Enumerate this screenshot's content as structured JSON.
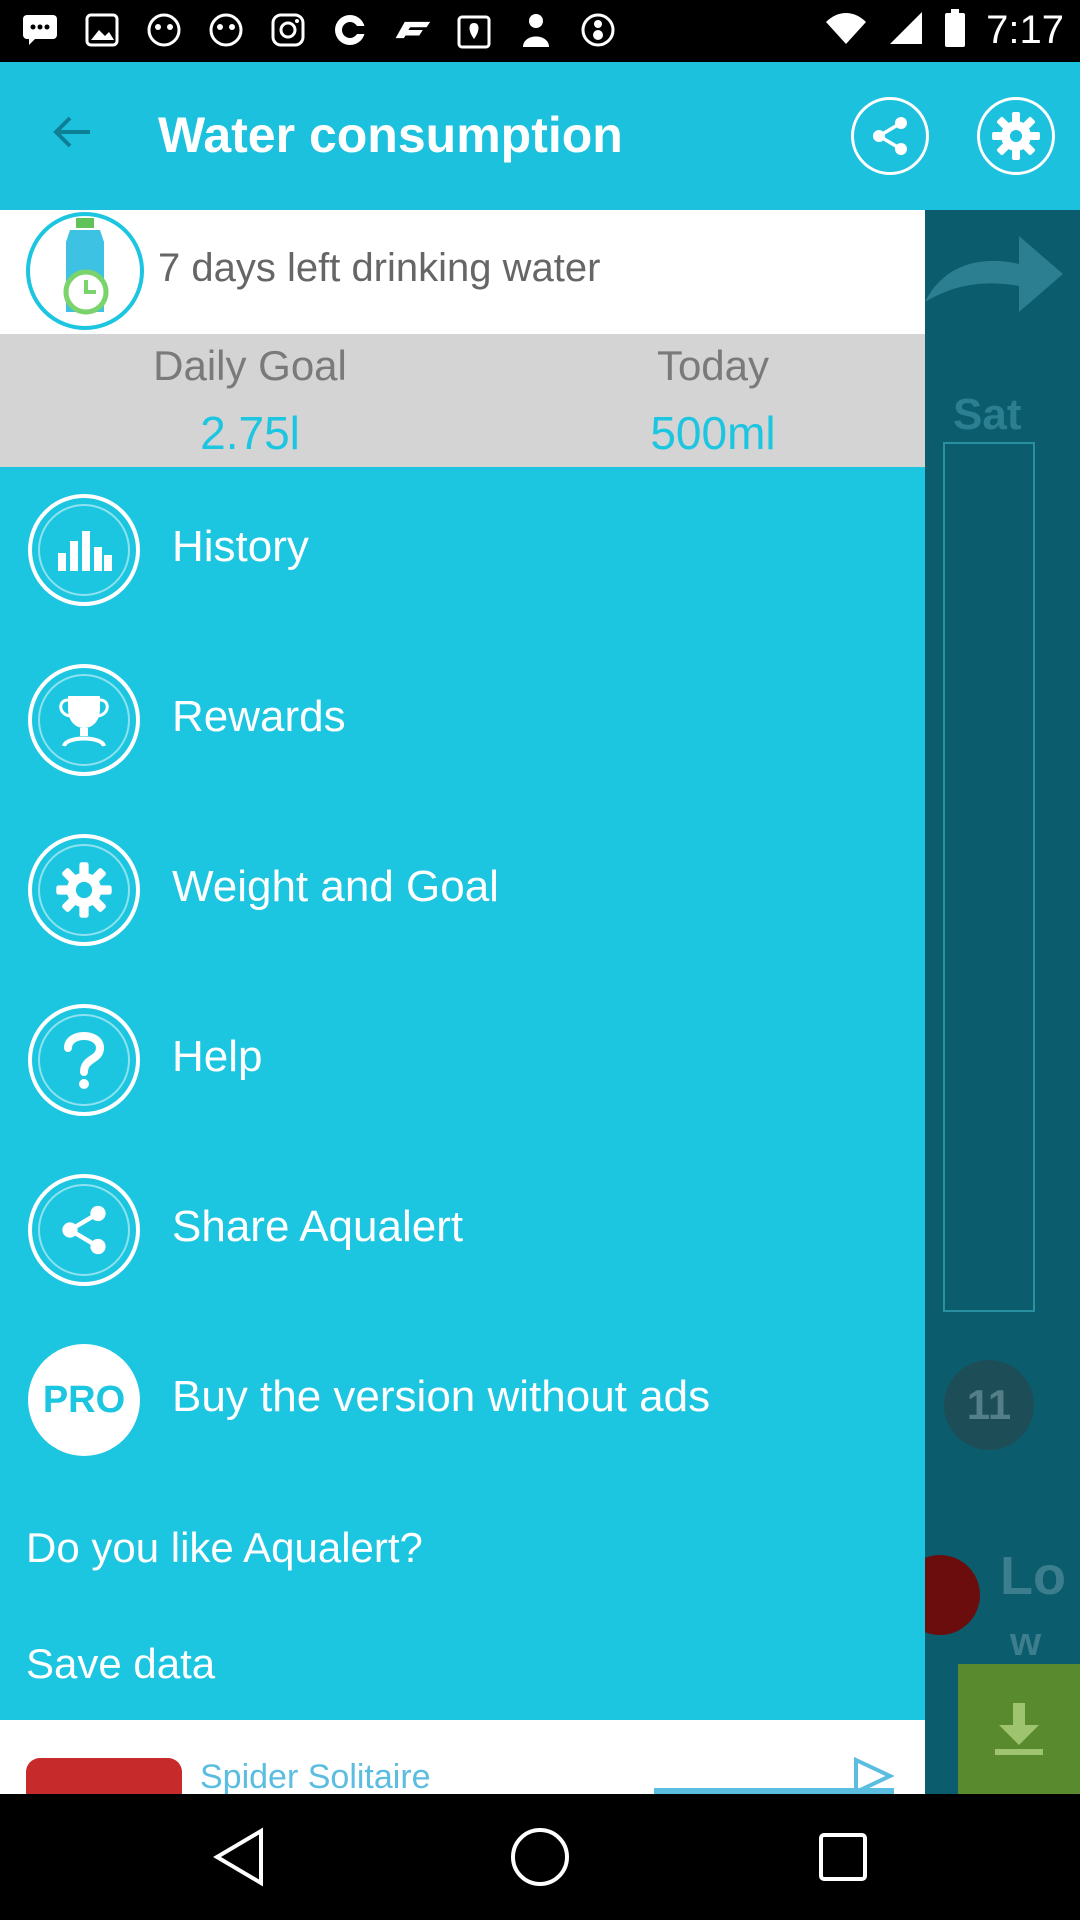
{
  "status_bar": {
    "time": "7:17",
    "left_icons": [
      "message-icon",
      "photo-icon",
      "game-icon",
      "game-icon",
      "instagram-icon",
      "circle-app-icon",
      "f1-icon",
      "fake-gps-icon",
      "person-icon",
      "8ball-icon"
    ],
    "right_icons": [
      "wifi-icon",
      "signal-icon",
      "battery-icon"
    ]
  },
  "app_bar": {
    "title": "Water consumption",
    "back_icon": "arrow-back-icon",
    "share_icon": "share-icon",
    "settings_icon": "gear-icon",
    "color": "#1cc1de"
  },
  "drawer": {
    "header_text": "7 days left drinking water",
    "daily_goal_label": "Daily Goal",
    "daily_goal_value": "2.75l",
    "today_label": "Today",
    "today_value": "500ml",
    "items": [
      {
        "label": "History",
        "icon": "bar-chart-icon"
      },
      {
        "label": "Rewards",
        "icon": "trophy-icon"
      },
      {
        "label": "Weight and Goal",
        "icon": "gear-icon"
      },
      {
        "label": "Help",
        "icon": "question-icon"
      },
      {
        "label": "Share Aqualert",
        "icon": "share-icon"
      },
      {
        "label": "Buy the version without ads",
        "icon": "pro-badge-icon",
        "badge": "PRO"
      }
    ],
    "like_text": "Do you like Aqualert?",
    "save_text": "Save data",
    "ad_title": "Spider Solitaire"
  },
  "background": {
    "day_label": "Sat",
    "day_number": "11",
    "lo_text": "Lo",
    "w_text": "w"
  }
}
